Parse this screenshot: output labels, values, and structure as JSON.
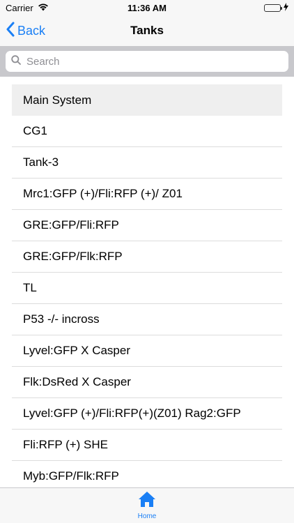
{
  "status_bar": {
    "carrier": "Carrier",
    "time": "11:36 AM"
  },
  "nav": {
    "back_label": "Back",
    "title": "Tanks"
  },
  "search": {
    "placeholder": "Search",
    "value": ""
  },
  "list": {
    "items": [
      "Main System",
      "CG1",
      "Tank-3",
      "Mrc1:GFP (+)/Fli:RFP (+)/ Z01",
      "GRE:GFP/Fli:RFP",
      "GRE:GFP/Flk:RFP",
      "TL",
      "P53 -/- incross",
      "Lyvel:GFP X Casper",
      "Flk:DsRed X Casper",
      "Lyvel:GFP (+)/Fli:RFP(+)(Z01) Rag2:GFP",
      "Fli:RFP (+) SHE",
      "Myb:GFP/Flk:RFP"
    ],
    "selected_index": 0
  },
  "tab_bar": {
    "tabs": [
      {
        "label": "Home",
        "icon": "home-icon",
        "active": true
      }
    ]
  },
  "colors": {
    "accent": "#1a7ff5",
    "bar_background": "#f7f7f7",
    "search_background": "#c8c8cc",
    "selected_row": "#efefef",
    "battery": "#4cd964"
  }
}
